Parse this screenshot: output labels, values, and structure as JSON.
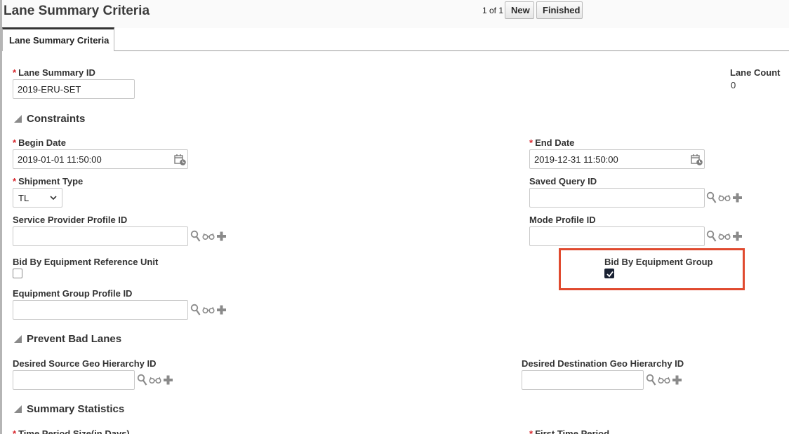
{
  "header": {
    "title": "Lane Summary Criteria",
    "pager": "1 of 1",
    "new_label": "New",
    "finished_label": "Finished"
  },
  "tab": {
    "label": "Lane Summary Criteria"
  },
  "fields": {
    "lane_summary_id": {
      "label": "Lane Summary ID",
      "required": "*",
      "value": "2019-ERU-SET"
    },
    "lane_count": {
      "label": "Lane Count",
      "value": "0"
    },
    "begin_date": {
      "label": "Begin Date",
      "required": "*",
      "value": "2019-01-01 11:50:00"
    },
    "end_date": {
      "label": "End Date",
      "required": "*",
      "value": "2019-12-31 11:50:00"
    },
    "shipment_type": {
      "label": "Shipment Type",
      "required": "*",
      "value": "TL"
    },
    "saved_query_id": {
      "label": "Saved Query ID",
      "value": ""
    },
    "service_provider_profile_id": {
      "label": "Service Provider Profile ID",
      "value": ""
    },
    "mode_profile_id": {
      "label": "Mode Profile ID",
      "value": ""
    },
    "bid_by_equipment_reference_unit": {
      "label": "Bid By Equipment Reference Unit",
      "checked": false
    },
    "bid_by_equipment_group": {
      "label": "Bid By Equipment Group",
      "checked": true
    },
    "equipment_group_profile_id": {
      "label": "Equipment Group Profile ID",
      "value": ""
    },
    "desired_source_geo_hierarchy_id": {
      "label": "Desired Source Geo Hierarchy ID",
      "value": ""
    },
    "desired_destination_geo_hierarchy_id": {
      "label": "Desired Destination Geo Hierarchy ID",
      "value": ""
    },
    "time_period_size": {
      "label": "Time Period Size(in Days)",
      "required": "*"
    },
    "first_time_period": {
      "label": "First Time Period",
      "required": "*"
    }
  },
  "sections": {
    "constraints": "Constraints",
    "prevent_bad_lanes": "Prevent Bad Lanes",
    "summary_statistics": "Summary Statistics"
  },
  "icons": {
    "calendar": "calendar-icon",
    "search": "search-icon",
    "details": "glasses-icon",
    "add": "plus-icon",
    "collapse": "triangle-collapse-icon"
  },
  "colors": {
    "required": "#d8262d",
    "highlight": "#e04a2f",
    "checked": "#1a2233"
  }
}
